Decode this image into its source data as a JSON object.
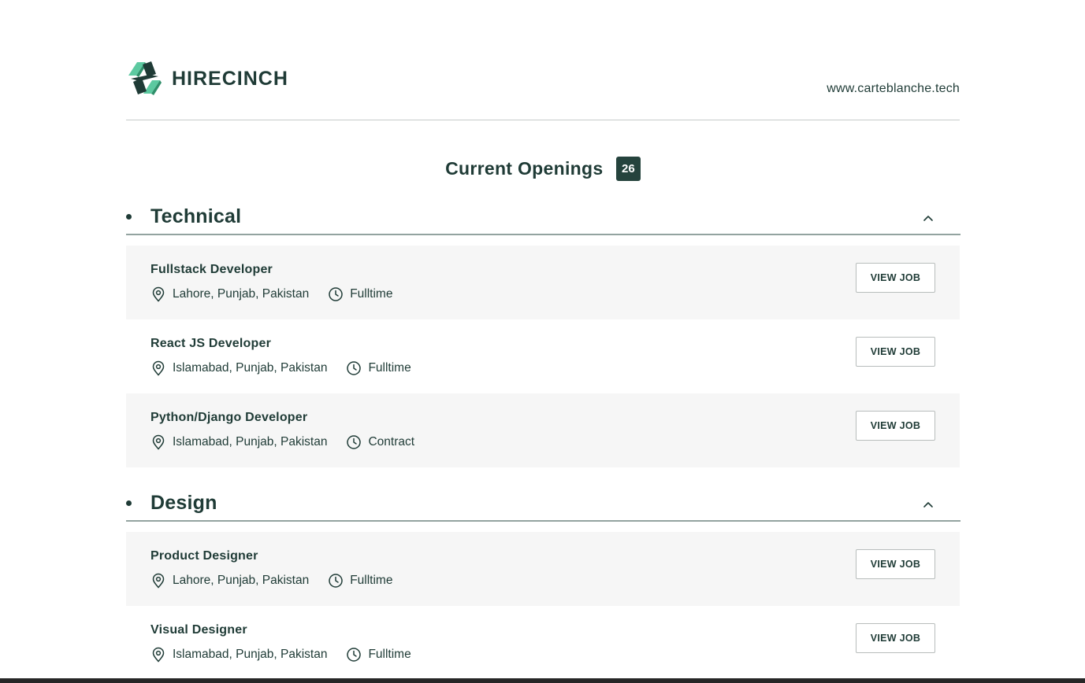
{
  "header": {
    "brand": "HIRECINCH",
    "site_link": "www.carteblanche.tech"
  },
  "openings": {
    "title": "Current Openings",
    "count": "26"
  },
  "view_job_label": "VIEW JOB",
  "categories": [
    {
      "name": "Technical",
      "jobs": [
        {
          "title": "Fullstack Developer",
          "location": "Lahore, Punjab, Pakistan",
          "type": "Fulltime"
        },
        {
          "title": "React JS Developer",
          "location": "Islamabad, Punjab, Pakistan",
          "type": "Fulltime"
        },
        {
          "title": "Python/Django Developer",
          "location": "Islamabad, Punjab, Pakistan",
          "type": "Contract"
        }
      ]
    },
    {
      "name": "Design",
      "jobs": [
        {
          "title": "Product Designer",
          "location": "Lahore, Punjab, Pakistan",
          "type": "Fulltime"
        },
        {
          "title": "Visual Designer",
          "location": "Islamabad, Punjab, Pakistan",
          "type": "Fulltime"
        }
      ]
    }
  ],
  "colors": {
    "primary": "#1f3b36",
    "badge": "#25433d",
    "logo_green": "#5cc9a0",
    "row_shade": "#f6f6f6"
  },
  "icons": {
    "location": "map-pin-icon",
    "job_type": "clock-icon",
    "toggle": "chevron-up-icon"
  }
}
